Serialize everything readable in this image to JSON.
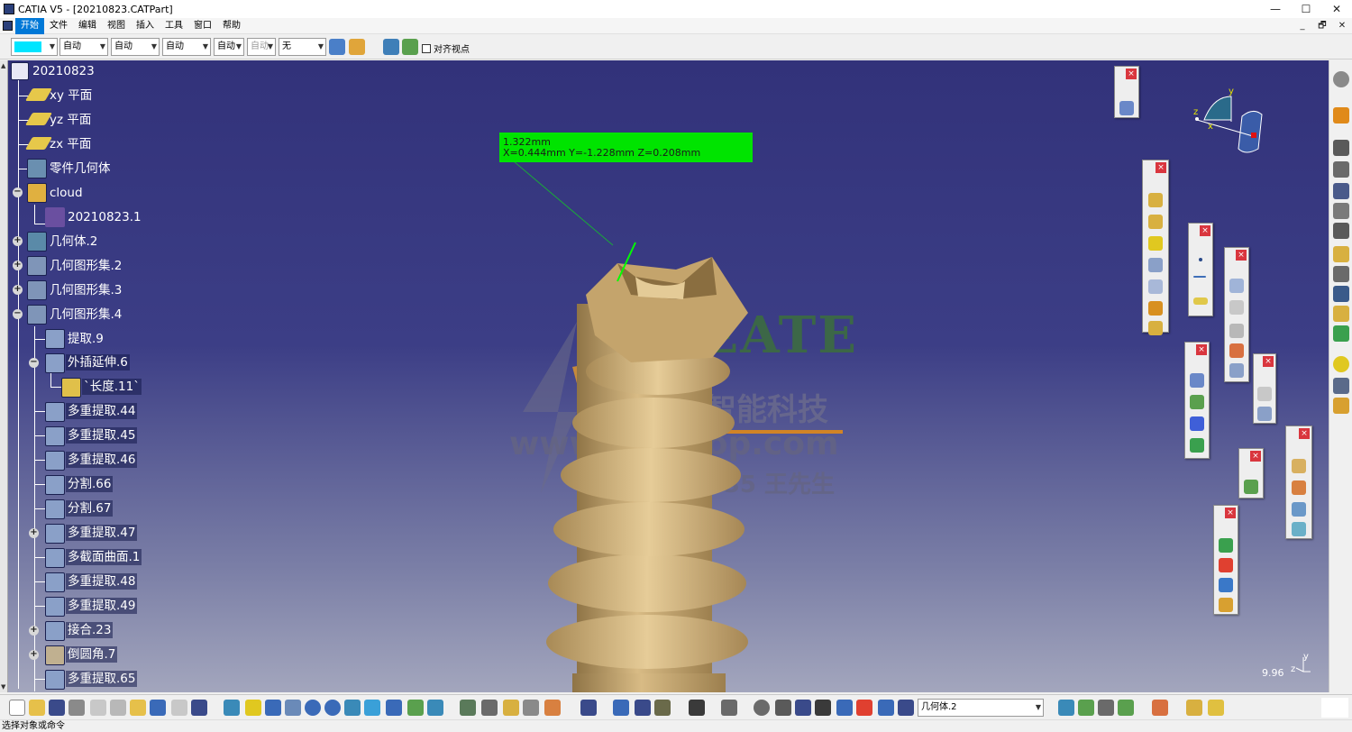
{
  "window": {
    "title": "CATIA V5 - [20210823.CATPart]",
    "minimize": "—",
    "maximize": "☐",
    "close": "✕",
    "restore": "🗗",
    "inner_close": "✕"
  },
  "menu": [
    {
      "label": "开始",
      "active": true
    },
    {
      "label": "文件"
    },
    {
      "label": "编辑"
    },
    {
      "label": "视图"
    },
    {
      "label": "插入"
    },
    {
      "label": "工具"
    },
    {
      "label": "窗口"
    },
    {
      "label": "帮助"
    }
  ],
  "toolbar": {
    "color_value": "",
    "combo1": "自动",
    "combo2": "自动",
    "combo3": "自动",
    "combo4": "自动",
    "combo5": "自动",
    "combo6": "无",
    "checkbox_label": "对齐视点"
  },
  "tree": {
    "root": "20210823",
    "items": [
      {
        "label": "xy 平面"
      },
      {
        "label": "yz 平面"
      },
      {
        "label": "zx 平面"
      },
      {
        "label": "零件几何体"
      },
      {
        "label": "cloud"
      },
      {
        "label": "20210823.1"
      },
      {
        "label": "几何体.2"
      },
      {
        "label": "几何图形集.2"
      },
      {
        "label": "几何图形集.3"
      },
      {
        "label": "几何图形集.4"
      },
      {
        "label": "提取.9"
      },
      {
        "label": "外插延伸.6"
      },
      {
        "label": "`长度.11`"
      },
      {
        "label": "多重提取.44"
      },
      {
        "label": "多重提取.45"
      },
      {
        "label": "多重提取.46"
      },
      {
        "label": "分割.66"
      },
      {
        "label": "分割.67"
      },
      {
        "label": "多重提取.47"
      },
      {
        "label": "多截面曲面.1"
      },
      {
        "label": "多重提取.48"
      },
      {
        "label": "多重提取.49"
      },
      {
        "label": "接合.23"
      },
      {
        "label": "倒圆角.7"
      },
      {
        "label": "多重提取.65"
      }
    ]
  },
  "measure": {
    "line1": "1.322mm",
    "line2": "X=0.444mm  Y=-1.228mm  Z=0.208mm"
  },
  "watermark": {
    "brand": "REATE",
    "company": "创感智能科技",
    "url": "www.szcntop.com",
    "phone": "13812763835 王先生"
  },
  "compass": {
    "x": "x",
    "y": "y",
    "z": "z"
  },
  "view_scale": "9.96",
  "axis": {
    "y": "y",
    "z": "z",
    "x": "x"
  },
  "bottom_combo": "几何体.2",
  "status": "选择对象或命令",
  "colors": {
    "accent": "#0078d7",
    "measure_bg": "#00e400",
    "model": "#c9aa72",
    "viewport_top": "#32327a",
    "palette_close": "#d9363e"
  }
}
